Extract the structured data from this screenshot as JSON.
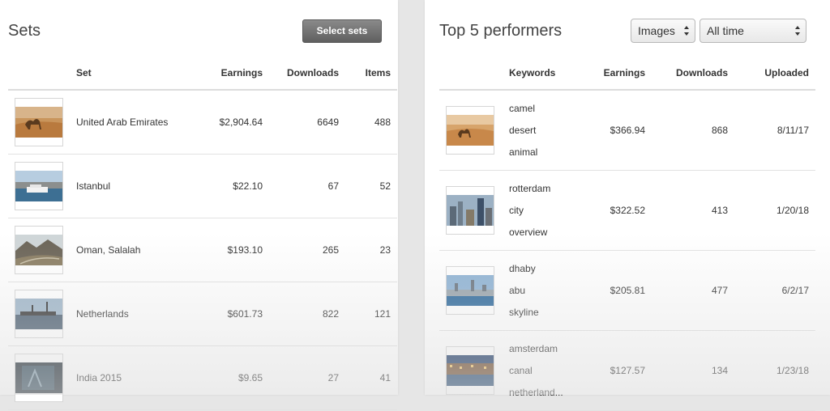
{
  "sets_panel": {
    "title": "Sets",
    "select_button": "Select sets",
    "columns": [
      "",
      "Set",
      "Earnings",
      "Downloads",
      "Items"
    ],
    "rows": [
      {
        "name": "United Arab Emirates",
        "earnings": "$2,904.64",
        "downloads": "6649",
        "items": "488",
        "thumb": "camel-desert-image"
      },
      {
        "name": "Istanbul",
        "earnings": "$22.10",
        "downloads": "67",
        "items": "52",
        "thumb": "ferry-city-image"
      },
      {
        "name": "Oman, Salalah",
        "earnings": "$193.10",
        "downloads": "265",
        "items": "23",
        "thumb": "mountain-road-image"
      },
      {
        "name": "Netherlands",
        "earnings": "$601.73",
        "downloads": "822",
        "items": "121",
        "thumb": "harbor-image"
      },
      {
        "name": "India 2015",
        "earnings": "$9.65",
        "downloads": "27",
        "items": "41",
        "thumb": "dark-interior-image"
      }
    ]
  },
  "top_panel": {
    "title": "Top 5 performers",
    "type_select": "Images",
    "time_select": "All time",
    "columns": [
      "",
      "Keywords",
      "Earnings",
      "Downloads",
      "Uploaded"
    ],
    "rows": [
      {
        "keywords": [
          "camel",
          "desert",
          "animal"
        ],
        "earnings": "$366.94",
        "downloads": "868",
        "uploaded": "8/11/17",
        "thumb": "camel-desert-image"
      },
      {
        "keywords": [
          "rotterdam",
          "city",
          "overview"
        ],
        "earnings": "$322.52",
        "downloads": "413",
        "uploaded": "1/20/18",
        "thumb": "city-skyline-image"
      },
      {
        "keywords": [
          "dhaby",
          "abu",
          "skyline"
        ],
        "earnings": "$205.81",
        "downloads": "477",
        "uploaded": "6/2/17",
        "thumb": "skyline-image"
      },
      {
        "keywords": [
          "amsterdam",
          "canal",
          "netherland..."
        ],
        "earnings": "$127.57",
        "downloads": "134",
        "uploaded": "1/23/18",
        "thumb": "canal-night-image"
      }
    ]
  }
}
